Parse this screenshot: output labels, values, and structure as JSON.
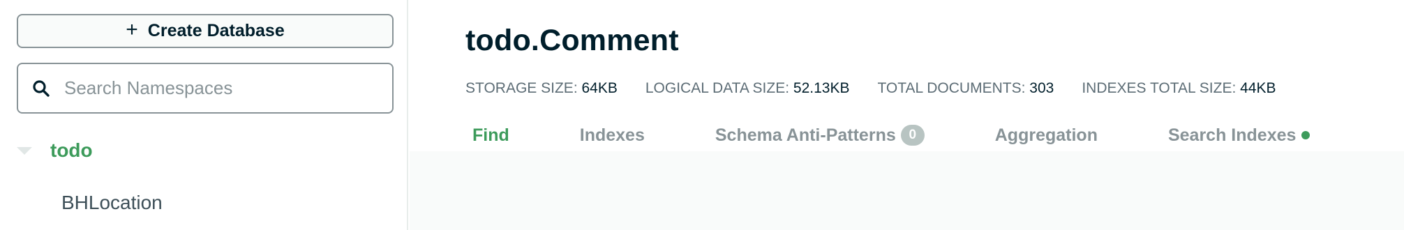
{
  "sidebar": {
    "create_button_label": "Create Database",
    "create_button_icon": "plus-icon",
    "search": {
      "placeholder": "Search Namespaces",
      "icon": "search-icon"
    },
    "databases": [
      {
        "name": "todo",
        "expanded": true,
        "collections": [
          "BHLocation"
        ]
      }
    ]
  },
  "main": {
    "title": "todo.Comment",
    "stats": [
      {
        "label": "STORAGE SIZE:",
        "value": "64KB"
      },
      {
        "label": "LOGICAL DATA SIZE:",
        "value": "52.13KB"
      },
      {
        "label": "TOTAL DOCUMENTS:",
        "value": "303"
      },
      {
        "label": "INDEXES TOTAL SIZE:",
        "value": "44KB"
      }
    ],
    "tabs": [
      {
        "label": "Find",
        "active": true
      },
      {
        "label": "Indexes"
      },
      {
        "label": "Schema Anti-Patterns",
        "badge": "0"
      },
      {
        "label": "Aggregation"
      },
      {
        "label": "Search Indexes",
        "status": "green-dot"
      }
    ]
  },
  "colors": {
    "accent": "#3d9b5b",
    "text": "#001e2b",
    "muted": "#889397"
  }
}
